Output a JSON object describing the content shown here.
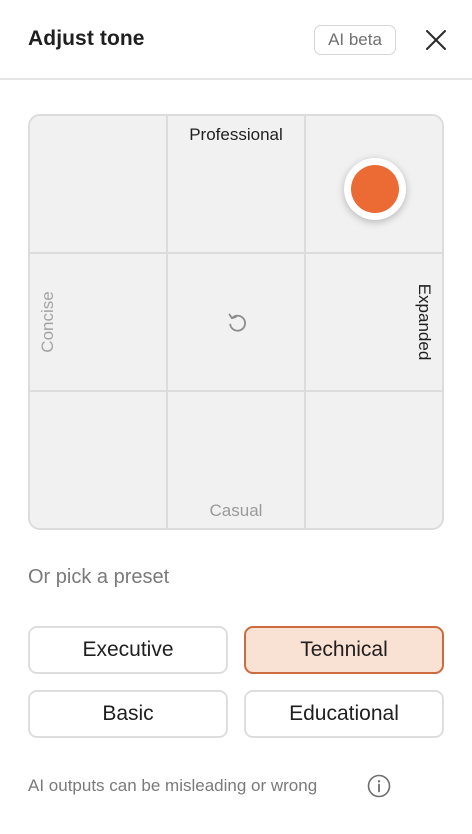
{
  "header": {
    "title": "Adjust tone",
    "badge": "AI beta",
    "close_icon": "close-icon"
  },
  "tone_grid": {
    "top_label": "Professional",
    "bottom_label": "Casual",
    "left_label": "Concise",
    "right_label": "Expanded",
    "reset_icon": "reset-icon",
    "selected_cell": {
      "row": 0,
      "col": 2
    },
    "handle_color": "#ec6b35"
  },
  "presets": {
    "title": "Or pick a preset",
    "items": [
      {
        "label": "Executive",
        "selected": false
      },
      {
        "label": "Technical",
        "selected": true
      },
      {
        "label": "Basic",
        "selected": false
      },
      {
        "label": "Educational",
        "selected": false
      }
    ],
    "selected_bg": "#f9e1d3",
    "selected_border": "#cc6a40"
  },
  "footer": {
    "disclaimer": "AI outputs can be misleading or wrong",
    "info_icon": "info-icon"
  }
}
